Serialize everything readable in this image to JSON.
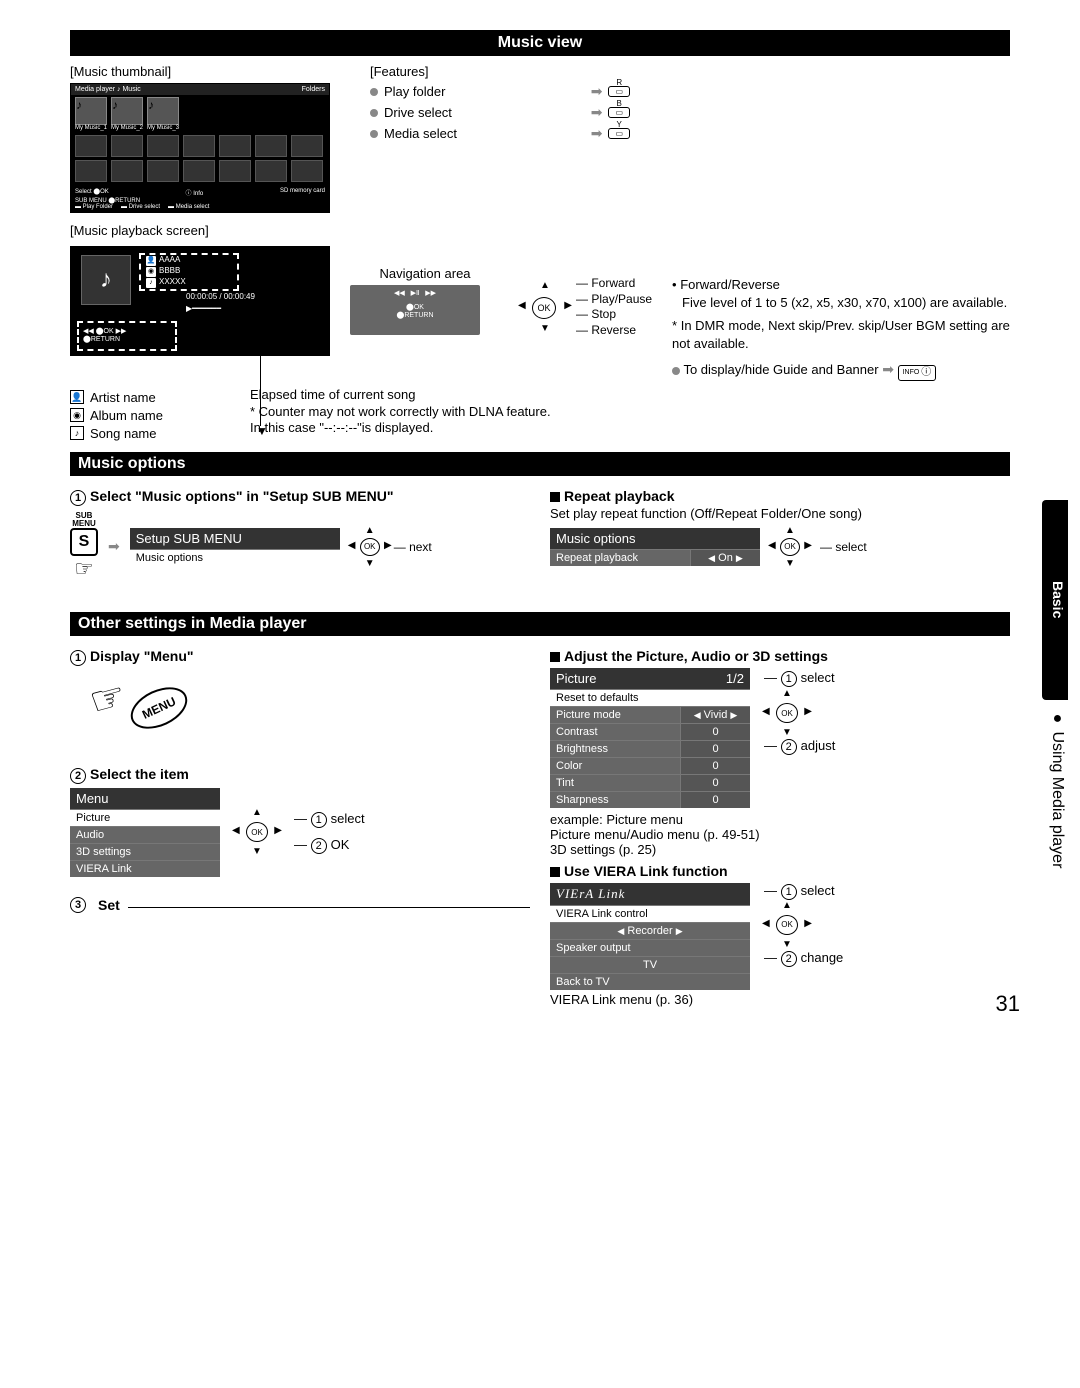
{
  "header": {
    "music_view": "Music view"
  },
  "thumbnail": {
    "label": "[Music thumbnail]",
    "top_left": "Media player",
    "top_music": "Music",
    "top_right": "Folders",
    "folder1": "My Music_1",
    "folder2": "My Music_2",
    "folder3": "My Music_3",
    "bottom1": "Select",
    "bottom2": "OK",
    "bottom3": "SUB MENU",
    "bottom4": "RETURN",
    "bottom5": "Info",
    "bottom6": "SD memory card",
    "bottom7": "Play Folder",
    "bottom8": "Drive select",
    "bottom9": "Media select"
  },
  "features": {
    "label": "[Features]",
    "items": [
      {
        "text": "Play folder",
        "btn": "R"
      },
      {
        "text": "Drive select",
        "btn": "B"
      },
      {
        "text": "Media select",
        "btn": "Y"
      }
    ]
  },
  "playback": {
    "label": "[Music playback screen]",
    "aaaa": "AAAA",
    "bbbb": "BBBB",
    "xxxx": "XXXXX",
    "time": "00:00:05 / 00:00:49",
    "ok": "OK",
    "return": "RETURN",
    "nav_label": "Navigation area",
    "dpad": {
      "forward": "Forward",
      "play": "Play/Pause",
      "stop": "Stop",
      "reverse": "Reverse",
      "ok": "OK"
    },
    "notes": {
      "fr_title": "Forward/Reverse",
      "fr_body": "Five level of 1 to 5 (x2, x5, x30, x70, x100) are available.",
      "dmr": "* In DMR mode, Next skip/Prev. skip/User BGM setting are not available.",
      "guide": "To display/hide Guide and Banner",
      "info": "INFO"
    },
    "legend": {
      "artist": "Artist name",
      "album": "Album name",
      "song": "Song name"
    },
    "elapsed": {
      "t1": "Elapsed time of current song",
      "t2": "* Counter may not work correctly with DLNA feature.",
      "t3": "In this case \"--:--:--\"is displayed."
    }
  },
  "options": {
    "title": "Music options",
    "step1": "Select \"Music options\" in \"Setup SUB MENU\"",
    "sub": "SUB",
    "menu": "MENU",
    "panel_title": "Setup SUB MENU",
    "panel_item": "Music options",
    "next": "next",
    "repeat_h": "Repeat playback",
    "repeat_body": "Set play repeat function (Off/Repeat Folder/One song)",
    "repeat_panel_title": "Music options",
    "repeat_row": "Repeat playback",
    "repeat_val": "On",
    "select": "select"
  },
  "other": {
    "title": "Other settings in Media player",
    "step1": "Display \"Menu\"",
    "menu_btn": "MENU",
    "step2": "Select the item",
    "menu_title": "Menu",
    "menu_items": [
      "Picture",
      "Audio",
      "3D settings",
      "VIERA Link"
    ],
    "sel": "select",
    "ok": "OK",
    "step3": "Set",
    "adjust_h": "Adjust the Picture, Audio or 3D settings",
    "picture": {
      "title": "Picture",
      "page": "1/2",
      "reset": "Reset to defaults",
      "rows": [
        {
          "n": "Picture mode",
          "v": "Vivid",
          "arrows": true
        },
        {
          "n": "Contrast",
          "v": "0"
        },
        {
          "n": "Brightness",
          "v": "0"
        },
        {
          "n": "Color",
          "v": "0"
        },
        {
          "n": "Tint",
          "v": "0"
        },
        {
          "n": "Sharpness",
          "v": "0"
        }
      ],
      "ex": "example: Picture menu",
      "ref1": "Picture menu/Audio menu (p. 49-51)",
      "ref2": "3D settings (p. 25)",
      "sel": "select",
      "adj": "adjust"
    },
    "viera": {
      "h": "Use VIERA Link function",
      "title": "VIErA Link",
      "r1": "VIERA Link control",
      "r1v": "Recorder",
      "r2": "Speaker output",
      "r2v": "TV",
      "r3": "Back to TV",
      "sel": "select",
      "chg": "change",
      "ref": "VIERA Link menu (p. 36)"
    }
  },
  "side": {
    "basic": "Basic",
    "using": "Using Media player",
    "dot": "●"
  },
  "page": "31"
}
